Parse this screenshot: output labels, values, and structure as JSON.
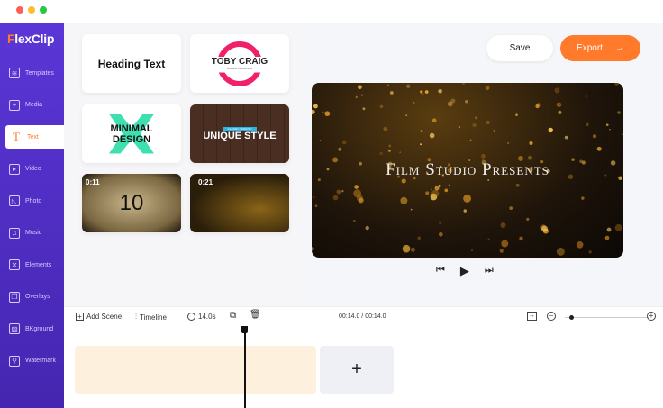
{
  "window": {
    "dots": [
      "#ff5f57",
      "#febc2e",
      "#28c840"
    ]
  },
  "sidebar": {
    "logo_prefix": "F",
    "logo_rest": "lexClip",
    "items": [
      {
        "label": "Templates",
        "icon": "layers-icon",
        "glyph": "≋"
      },
      {
        "label": "Media",
        "icon": "folder-plus-icon",
        "glyph": "+"
      },
      {
        "label": "Text",
        "icon": "text-icon",
        "glyph": "T",
        "active": true
      },
      {
        "label": "Video",
        "icon": "video-icon",
        "glyph": "▸"
      },
      {
        "label": "Photo",
        "icon": "image-icon",
        "glyph": "◺"
      },
      {
        "label": "Music",
        "icon": "music-icon",
        "glyph": "♫"
      },
      {
        "label": "Elements",
        "icon": "shapes-icon",
        "glyph": "✕"
      },
      {
        "label": "Overlays",
        "icon": "overlays-icon",
        "glyph": "❐"
      },
      {
        "label": "BKground",
        "icon": "background-icon",
        "glyph": "▨"
      },
      {
        "label": "Watermark",
        "icon": "stamp-icon",
        "glyph": "⚲"
      }
    ]
  },
  "templates": {
    "heading": "Heading Text",
    "toby": "TOBY CRAIG",
    "toby_sub": "WORLD CHAMPION",
    "minimal1": "MINIMAL",
    "minimal2": "DESIGN",
    "unique_tag": "CLASSIC SMOOTH",
    "unique": "UNIQUE STYLE",
    "film_time": "0:11",
    "film_number": "10",
    "gold_time": "0:21"
  },
  "header": {
    "save": "Save",
    "export": "Export",
    "accent": "#ff7a2a"
  },
  "preview": {
    "title": "Film Studio Presents"
  },
  "toolbar": {
    "add_scene": "Add Scene",
    "timeline": "Timeline",
    "duration": "14.0s",
    "time": "00:14.0 / 00:14.0",
    "zoom_level": 0.05
  },
  "timeline": {
    "add": "+",
    "scene_color": "#fdf0dc"
  }
}
